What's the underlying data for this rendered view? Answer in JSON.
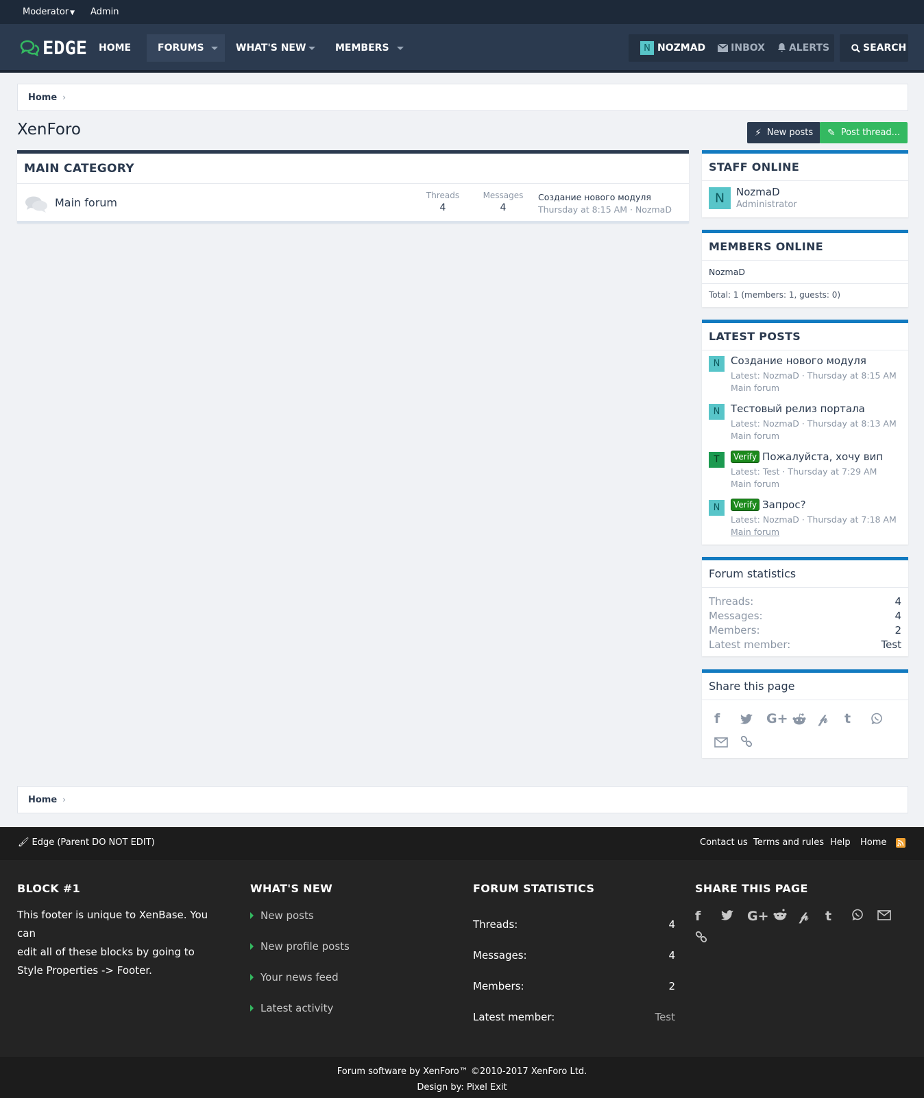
{
  "topbar": {
    "moderator": "Moderator",
    "admin": "Admin"
  },
  "logo": {
    "text": "EDGE"
  },
  "nav": {
    "home": "HOME",
    "forums": "FORUMS",
    "whats_new": "WHAT'S NEW",
    "members": "MEMBERS",
    "user": "NOZMAD",
    "user_initial": "N",
    "inbox": "INBOX",
    "alerts": "ALERTS",
    "search": "SEARCH"
  },
  "breadcrumb": {
    "home": "Home"
  },
  "page": {
    "title": "XenForo",
    "new_posts": "New posts",
    "post_thread": "Post thread..."
  },
  "category": {
    "title": "MAIN CATEGORY",
    "forum": {
      "name": "Main forum",
      "threads_label": "Threads",
      "threads": "4",
      "messages_label": "Messages",
      "messages": "4",
      "last_title": "Создание нового модуля",
      "last_time": "Thursday at 8:15 AM",
      "last_sep": " · ",
      "last_user": "NozmaD"
    }
  },
  "staff_online": {
    "title": "STAFF ONLINE",
    "initial": "N",
    "name": "NozmaD",
    "role": "Administrator"
  },
  "members_online": {
    "title": "MEMBERS ONLINE",
    "member": "NozmaD",
    "total": "Total: 1 (members: 1, guests: 0)"
  },
  "latest_posts": {
    "title": "LATEST POSTS",
    "verify": "Verify",
    "items": [
      {
        "initial": "N",
        "title": "Создание нового модуля",
        "meta": "Latest: NozmaD · Thursday at 8:15 AM",
        "forum": "Main forum"
      },
      {
        "initial": "N",
        "title": "Тестовый релиз портала",
        "meta": "Latest: NozmaD · Thursday at 8:13 AM",
        "forum": "Main forum"
      },
      {
        "initial": "T",
        "title": "Пожалуйста, хочу вип",
        "meta": "Latest: Test · Thursday at 7:29 AM",
        "forum": "Main forum"
      },
      {
        "initial": "N",
        "title": "Запрос?",
        "meta": "Latest: NozmaD · Thursday at 7:18 AM",
        "forum": "Main forum"
      }
    ]
  },
  "forum_stats": {
    "title": "Forum statistics",
    "threads_label": "Threads:",
    "threads": "4",
    "messages_label": "Messages:",
    "messages": "4",
    "members_label": "Members:",
    "members": "2",
    "latest_label": "Latest member:",
    "latest": "Test"
  },
  "share": {
    "title": "Share this page",
    "icons": [
      "facebook-icon",
      "twitter-icon",
      "google-plus-icon",
      "reddit-icon",
      "pinterest-icon",
      "tumblr-icon",
      "whatsapp-icon",
      "email-icon",
      "link-icon"
    ]
  },
  "footbar": {
    "style": "Edge (Parent DO NOT EDIT)",
    "contact": "Contact us",
    "terms": "Terms and rules",
    "help": "Help",
    "home": "Home"
  },
  "footer": {
    "block1": {
      "title": "BLOCK #1",
      "line1": "This footer is unique to XenBase. You can",
      "line2": "edit all of these blocks by going to",
      "line3": "Style Properties -> Footer."
    },
    "whats_new": {
      "title": "WHAT'S NEW",
      "links": [
        "New posts",
        "New profile posts",
        "Your news feed",
        "Latest activity"
      ]
    },
    "stats": {
      "title": "FORUM STATISTICS",
      "threads_label": "Threads:",
      "threads": "4",
      "messages_label": "Messages:",
      "messages": "4",
      "members_label": "Members:",
      "members": "2",
      "latest_label": "Latest member:",
      "latest": "Test"
    },
    "share": {
      "title": "SHARE THIS PAGE"
    }
  },
  "copyright": {
    "line1": "Forum software by XenForo™ ©2010-2017 XenForo Ltd.",
    "line2": "Design by: Pixel Exit"
  },
  "colors": {
    "accent_blue": "#127ac0",
    "nav_dark": "#2b3a4f",
    "green": "#34b961",
    "avatar": "#58c5c9"
  }
}
